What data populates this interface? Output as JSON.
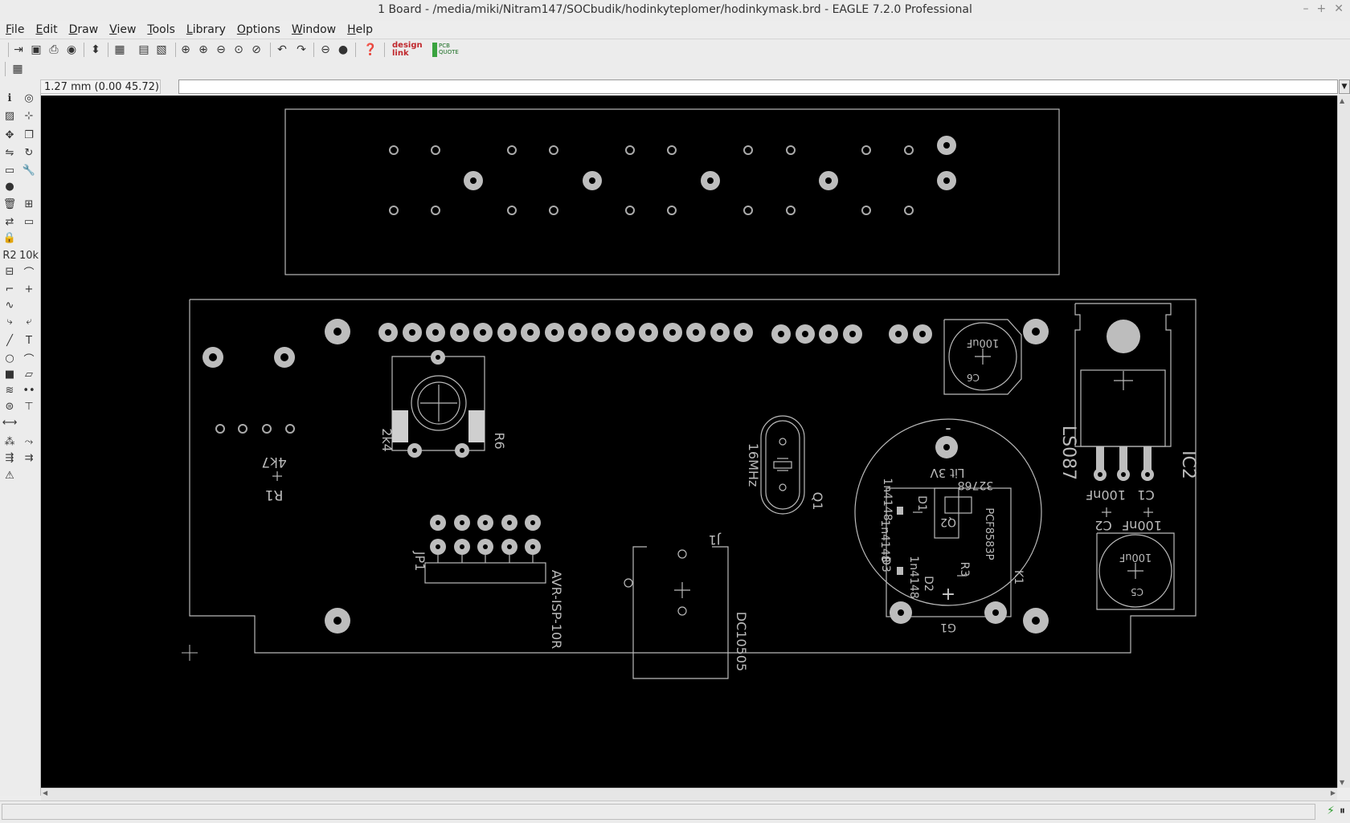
{
  "window": {
    "title": "1 Board - /media/miki/Nitram147/SOCbudik/hodinkyteplomer/hodinkymask.brd - EAGLE 7.2.0 Professional",
    "controls": [
      "–",
      "+",
      "✕"
    ]
  },
  "menubar": {
    "items": [
      {
        "label": "File",
        "accel": "F",
        "rest": "ile"
      },
      {
        "label": "Edit",
        "accel": "E",
        "rest": "dit"
      },
      {
        "label": "Draw",
        "accel": "D",
        "rest": "raw"
      },
      {
        "label": "View",
        "accel": "V",
        "rest": "iew"
      },
      {
        "label": "Tools",
        "accel": "T",
        "rest": "ools"
      },
      {
        "label": "Library",
        "accel": "L",
        "rest": "ibrary"
      },
      {
        "label": "Options",
        "accel": "O",
        "rest": "ptions"
      },
      {
        "label": "Window",
        "accel": "W",
        "rest": "indow"
      },
      {
        "label": "Help",
        "accel": "H",
        "rest": "elp"
      }
    ]
  },
  "commandbar": {
    "coordinate": "1.27 mm (0.00 45.72)",
    "command_value": ""
  },
  "toolbar": {
    "designlink_label": "design link",
    "pcbquote_label": "PCB QUOTE"
  },
  "board": {
    "labels": {
      "r1_value": "4k7",
      "r1_name": "R1",
      "r6_value": "2k4",
      "r6_name": "R6",
      "jp1_name": "JP1",
      "jp1_value": "AVR-ISP-10R",
      "j1_name": "J1",
      "j1_value": "DC10505",
      "q1_value": "16MHz",
      "q1_name": "Q1",
      "ic2_name": "IC2",
      "ic2_value": "LS087",
      "c6_value": "100uF",
      "c6_name": "C6",
      "c5_value": "100uF",
      "c5_name": "C5",
      "c1_name": "C1",
      "c1_value": "100nF",
      "c2_name": "C2",
      "c2_value": "100nF",
      "d1_name": "D1",
      "d1_value": "1n4148",
      "d2_name": "D2",
      "d2_value": "1n4148",
      "q2_name": "Q2",
      "bat_value": "Lit 3V",
      "bat_minus": "-",
      "bat_plus": "+",
      "x1_value": "32768",
      "k1_name": "K1",
      "k1_value": "PCF8583P",
      "g1_name": "G1",
      "r3_name": "R3",
      "d3_value": "1n4148",
      "d3_name": "D3"
    }
  },
  "status": {
    "message": ""
  }
}
